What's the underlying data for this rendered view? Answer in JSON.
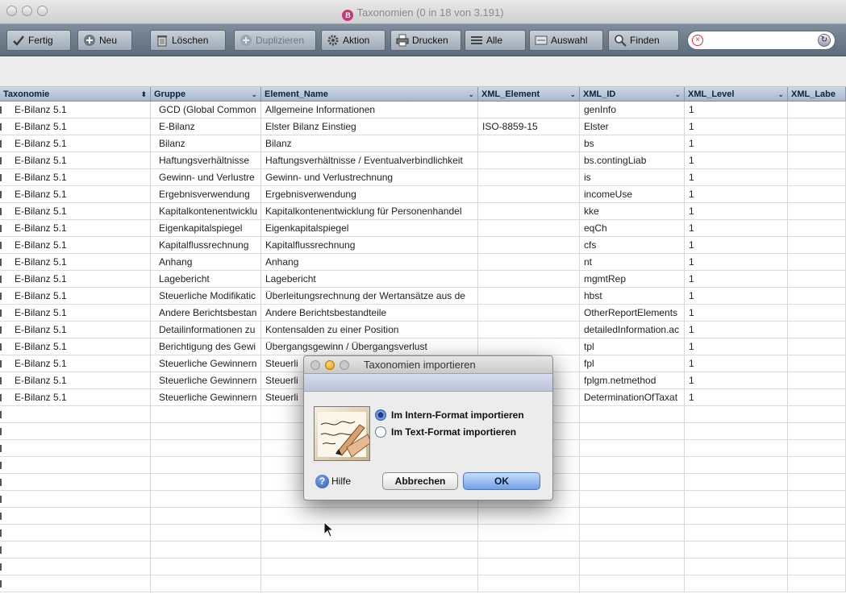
{
  "window": {
    "title": "Taxonomien (0 in 18 von 3.191)"
  },
  "toolbar": {
    "items": [
      {
        "label": "Fertig",
        "icon": "check-icon"
      },
      {
        "label": "Neu",
        "icon": "plus-icon"
      },
      {
        "label": "Löschen",
        "icon": "trash-icon"
      },
      {
        "label": "Duplizieren",
        "icon": "duplicate-icon"
      },
      {
        "label": "Aktion",
        "icon": "gear-icon"
      },
      {
        "label": "Drucken",
        "icon": "printer-icon"
      },
      {
        "label": "Alle",
        "icon": "list-icon"
      },
      {
        "label": "Auswahl",
        "icon": "selection-icon"
      },
      {
        "label": "Finden",
        "icon": "magnifier-icon"
      }
    ],
    "search": {
      "value": ""
    }
  },
  "table": {
    "columns": [
      "Taxonomie",
      "Gruppe",
      "Element_Name",
      "XML_Element",
      "XML_ID",
      "XML_Level",
      "XML_Labe"
    ],
    "rows": [
      [
        "E-Bilanz 5.1",
        "GCD (Global Common",
        "Allgemeine Informationen",
        "",
        "genInfo",
        "1",
        ""
      ],
      [
        "E-Bilanz 5.1",
        "E-Bilanz",
        "Elster Bilanz Einstieg",
        "ISO-8859-15",
        "Elster",
        "1",
        ""
      ],
      [
        "E-Bilanz 5.1",
        "Bilanz",
        "Bilanz",
        "",
        "bs",
        "1",
        ""
      ],
      [
        "E-Bilanz 5.1",
        "Haftungsverhältnisse",
        "Haftungsverhältnisse / Eventualverbindlichkeit",
        "",
        "bs.contingLiab",
        "1",
        ""
      ],
      [
        "E-Bilanz 5.1",
        "Gewinn- und Verlustre",
        "Gewinn- und Verlustrechnung",
        "",
        "is",
        "1",
        ""
      ],
      [
        "E-Bilanz 5.1",
        "Ergebnisverwendung",
        "Ergebnisverwendung",
        "",
        "incomeUse",
        "1",
        ""
      ],
      [
        "E-Bilanz 5.1",
        "Kapitalkontenentwicklu",
        "Kapitalkontenentwicklung für Personenhandel",
        "",
        "kke",
        "1",
        ""
      ],
      [
        "E-Bilanz 5.1",
        "Eigenkapitalspiegel",
        "Eigenkapitalspiegel",
        "",
        "eqCh",
        "1",
        ""
      ],
      [
        "E-Bilanz 5.1",
        "Kapitalflussrechnung",
        "Kapitalflussrechnung",
        "",
        "cfs",
        "1",
        ""
      ],
      [
        "E-Bilanz 5.1",
        "Anhang",
        "Anhang",
        "",
        "nt",
        "1",
        ""
      ],
      [
        "E-Bilanz 5.1",
        "Lagebericht",
        "Lagebericht",
        "",
        "mgmtRep",
        "1",
        ""
      ],
      [
        "E-Bilanz 5.1",
        "Steuerliche Modifikatic",
        "Überleitungsrechnung der Wertansätze aus de",
        "",
        "hbst",
        "1",
        ""
      ],
      [
        "E-Bilanz 5.1",
        "Andere Berichtsbestan",
        "Andere Berichtsbestandteile",
        "",
        "OtherReportElements",
        "1",
        ""
      ],
      [
        "E-Bilanz 5.1",
        "Detailinformationen zu",
        "Kontensalden zu einer Position",
        "",
        "detailedInformation.ac",
        "1",
        ""
      ],
      [
        "E-Bilanz 5.1",
        "Berichtigung des Gewi",
        "Übergangsgewinn / Übergangsverlust",
        "",
        "tpl",
        "1",
        ""
      ],
      [
        "E-Bilanz 5.1",
        "Steuerliche Gewinnern",
        "Steuerli",
        "",
        "fpl",
        "1",
        ""
      ],
      [
        "E-Bilanz 5.1",
        "Steuerliche Gewinnern",
        "Steuerli",
        "",
        "fplgm.netmethod",
        "1",
        ""
      ],
      [
        "E-Bilanz 5.1",
        "Steuerliche Gewinnern",
        "Steuerli",
        "",
        "DeterminationOfTaxat",
        "1",
        ""
      ]
    ]
  },
  "dialog": {
    "title": "Taxonomien importieren",
    "options": [
      {
        "label": "Im Intern-Format importieren",
        "selected": true
      },
      {
        "label": "Im Text-Format importieren",
        "selected": false
      }
    ],
    "help_label": "Hilfe",
    "cancel_label": "Abbrechen",
    "ok_label": "OK"
  },
  "colors": {
    "toolbar": "#6d7b8a",
    "header": "#b9c6d6",
    "ok_button": "#6fa0ea"
  }
}
